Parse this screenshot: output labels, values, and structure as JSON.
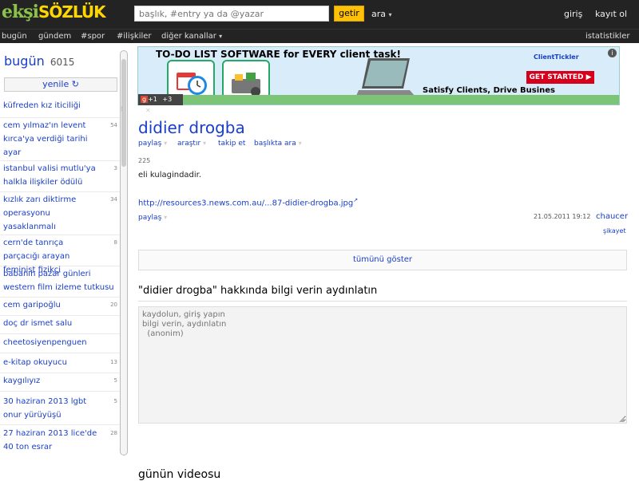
{
  "header": {
    "logo_part1": "ekşi",
    "logo_part2": "SÖZLÜK",
    "search_placeholder": "başlık, #entry ya da @yazar",
    "search_button": "getir",
    "ara": "ara",
    "login": "giriş",
    "register": "kayıt ol"
  },
  "nav": {
    "items": [
      "bugün",
      "gündem",
      "#spor",
      "#ilişkiler",
      "diğer kanallar"
    ],
    "stats": "istatistikler"
  },
  "sidebar": {
    "title": "bugün",
    "count": "6015",
    "refresh": "yenile ↻",
    "items": [
      {
        "label": "küfreden kız iticiliği",
        "count": ""
      },
      {
        "label": "cem yılmaz'ın levent kırca'ya verdiği tarihi ayar",
        "count": "54"
      },
      {
        "label": "istanbul valisi mutlu'ya halkla ilişkiler ödülü",
        "count": "3"
      },
      {
        "label": "kızlık zarı diktirme operasyonu yasaklanmalı",
        "count": "34"
      },
      {
        "label": "cern'de tanrıça parçacığı arayan feminist fizikçi",
        "count": "8"
      },
      {
        "label": "babanın pazar günleri western film izleme tutkusu",
        "count": ""
      },
      {
        "label": "cem garipoğlu",
        "count": "20"
      },
      {
        "label": "doç dr ismet salu",
        "count": ""
      },
      {
        "label": "cheetosiyenpenguen",
        "count": ""
      },
      {
        "label": "e-kitap okuyucu",
        "count": "13"
      },
      {
        "label": "kaygılıyız",
        "count": "5"
      },
      {
        "label": "30 haziran 2013 lgbt onur yürüyüşü",
        "count": "5"
      },
      {
        "label": "27 haziran 2013 lice'de 40 ton esrar",
        "count": "28"
      }
    ]
  },
  "ad": {
    "headline": "TO-DO LIST SOFTWARE for EVERY client task!",
    "brand": "ClientTickler",
    "cta": "GET STARTED",
    "tagline": "Satisfy Clients, Drive Busines",
    "gplus": "+1",
    "gplus_count": "+3"
  },
  "topic": {
    "title": "didier drogba",
    "actions": [
      "paylaş",
      "araştır",
      "takip et",
      "başlıkta ara"
    ]
  },
  "entry": {
    "number": "225",
    "text": "eli kulagindadir.",
    "link": "http://resources3.news.com.au/...87-didier-drogba.jpg",
    "share": "paylaş",
    "date": "21.05.2011 19:12",
    "author": "chaucer",
    "report": "şikayet"
  },
  "show_all": "tümünü göster",
  "info": {
    "title": "\"didier drogba\" hakkında bilgi verin aydınlatın",
    "placeholder": "kaydolun, giriş yapın\nbilgi verin, aydınlatın\n  (anonim)"
  },
  "video_title": "günün videosu"
}
